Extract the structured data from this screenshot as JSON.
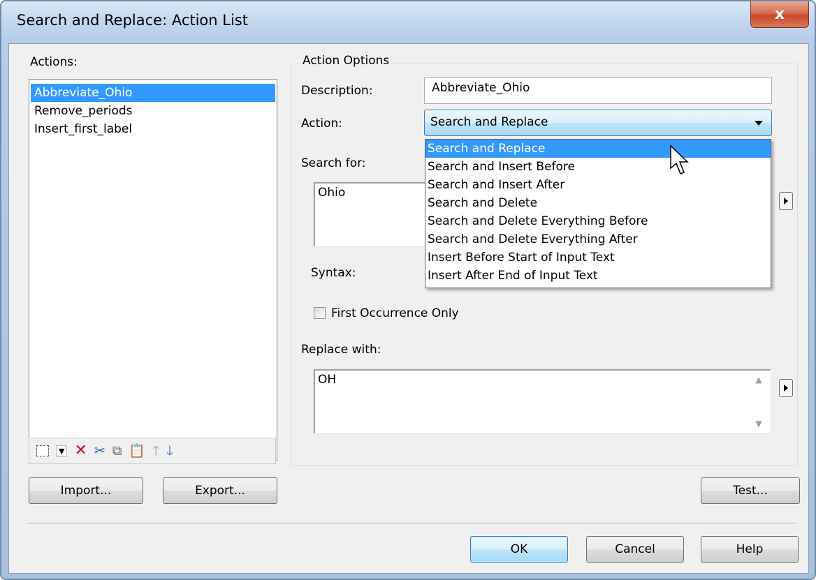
{
  "window": {
    "title": "Search and Replace: Action List",
    "close_label": "x"
  },
  "actions": {
    "label": "Actions:",
    "items": [
      "Abbreviate_Ohio",
      "Remove_periods",
      "Insert_first_label"
    ],
    "selected_index": 0
  },
  "toolbar": {
    "icons": [
      "new-action-icon",
      "dropdown-arrow-icon",
      "delete-icon",
      "cut-icon",
      "copy-icon",
      "paste-icon",
      "move-up-icon",
      "move-down-icon"
    ]
  },
  "options": {
    "group_title": "Action Options",
    "description_label": "Description:",
    "description_value": "Abbreviate_Ohio",
    "action_label": "Action:",
    "action_value": "Search and Replace",
    "action_options": [
      "Search and Replace",
      "Search and Insert Before",
      "Search and Insert After",
      "Search and Delete",
      "Search and Delete Everything Before",
      "Search and Delete Everything After",
      "Insert Before Start of Input Text",
      "Insert After End of Input Text"
    ],
    "search_label": "Search for:",
    "search_value": "Ohio",
    "syntax_label": "Syntax:",
    "first_occurrence_label": "First Occurrence Only",
    "first_occurrence_checked": false,
    "replace_label": "Replace with:",
    "replace_value": "OH"
  },
  "buttons": {
    "import": "Import...",
    "export": "Export...",
    "test": "Test...",
    "ok": "OK",
    "cancel": "Cancel",
    "help": "Help"
  },
  "colors": {
    "selection": "#3399ff",
    "title_close": "#c8482a"
  }
}
